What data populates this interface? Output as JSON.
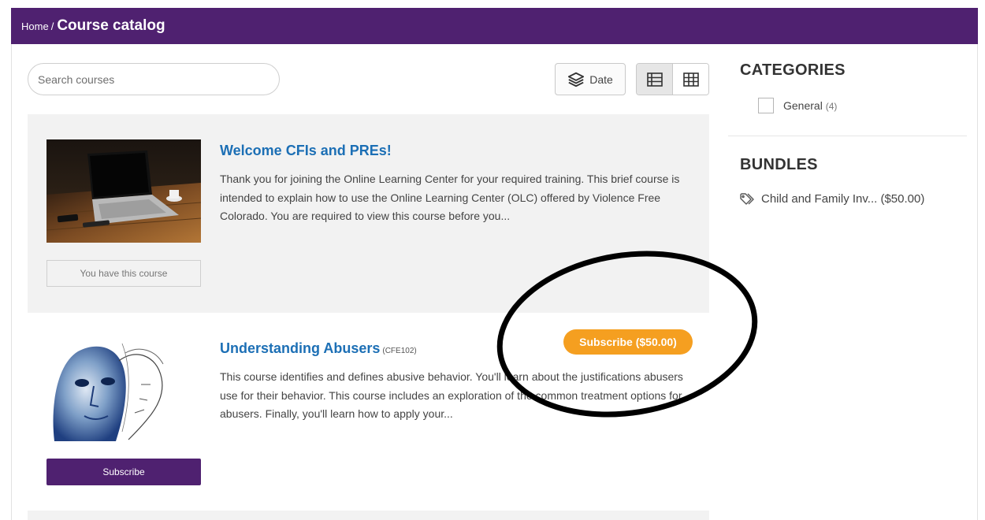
{
  "breadcrumb": {
    "home": "Home",
    "separator": "/",
    "current": "Course catalog"
  },
  "toolbar": {
    "search_placeholder": "Search courses",
    "sort_label": "Date",
    "sort_icon": "layers-icon",
    "view_list_icon": "list-view-icon",
    "view_grid_icon": "grid-view-icon"
  },
  "courses": [
    {
      "title": "Welcome CFIs and PREs!",
      "code": "",
      "description": "Thank you for joining the Online Learning Center for your required training. This brief course is intended to explain how to use the Online Learning Center (OLC) offered by Violence Free Colorado. You are required to view this course before you...",
      "action_label": "You have this course",
      "price_label": ""
    },
    {
      "title": "Understanding Abusers",
      "code": "(CFE102)",
      "description": "This course identifies and defines abusive behavior. You'll learn about the justifications abusers use for their behavior. This course includes an exploration of the common treatment options for abusers. Finally, you'll learn how to apply your...",
      "action_label": "Subscribe",
      "price_label": "Subscribe ($50.00)"
    }
  ],
  "sidebar": {
    "categories_heading": "CATEGORIES",
    "categories": [
      {
        "label": "General",
        "count": "(4)"
      }
    ],
    "bundles_heading": "BUNDLES",
    "bundles": [
      {
        "label": "Child and Family Inv... ($50.00)",
        "icon": "tag-icon"
      }
    ]
  },
  "colors": {
    "header_bg": "#4f2170",
    "link_blue": "#1c6fb5",
    "price_orange": "#f59f20",
    "card_gray": "#f2f2f2"
  }
}
